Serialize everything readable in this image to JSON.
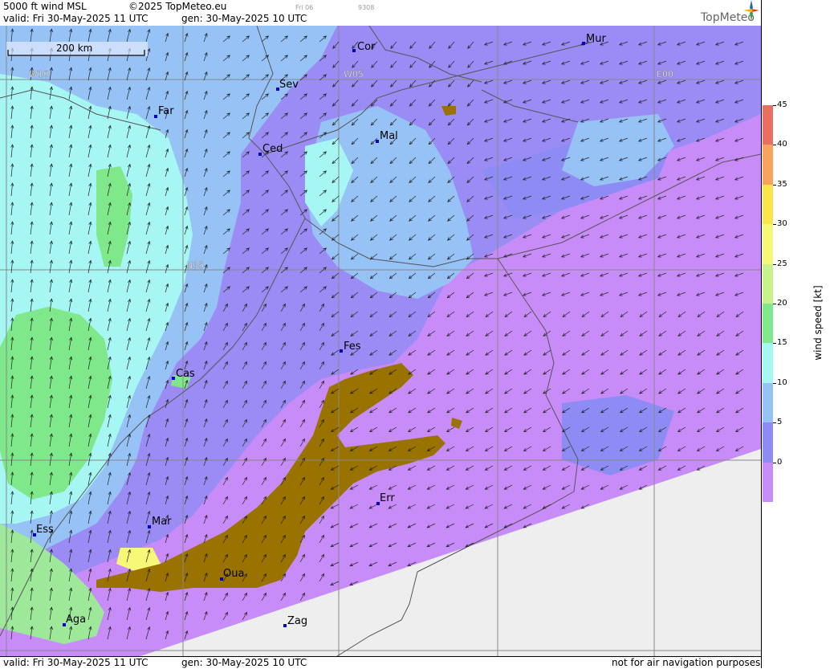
{
  "header": {
    "title": "5000 ft wind MSL",
    "copyright": "©2025 TopMeteo.eu",
    "valid": "valid:  Fri  30-May-2025  11 UTC",
    "gen": "gen: 30-May-2025 10 UTC",
    "small_day": "Fri 06",
    "small_code": "9308",
    "logo": "TopMeteo"
  },
  "footer": {
    "valid": "valid:  Fri  30-May-2025  11 UTC",
    "gen": "gen: 30-May-2025 10 UTC",
    "disclaimer": "not for air navigation purposes"
  },
  "map": {
    "scale_label": "200 km",
    "grid_labels": [
      "W10",
      "W05",
      "E00",
      "N35"
    ],
    "cities": [
      "Cor",
      "Mur",
      "Sev",
      "Far",
      "Ced",
      "Mal",
      "Fes",
      "Cas",
      "Err",
      "Mar",
      "Ess",
      "Oua",
      "Aga",
      "Zag"
    ],
    "colors": {
      "no_data": "#eeeeee",
      "high_terrain": "#9a7200",
      "borders": "#555555",
      "grid": "#888888",
      "city_marker": "#0000cc"
    }
  },
  "legend": {
    "title": "wind speed [kt]",
    "ticks": [
      "45",
      "40",
      "35",
      "30",
      "25",
      "20",
      "15",
      "10",
      "5",
      "0"
    ],
    "colors": [
      "#e87060",
      "#f7a35c",
      "#fce54a",
      "#f8f878",
      "#c8f28a",
      "#7ee88a",
      "#a6f6f4",
      "#96c2f6",
      "#8c8cf4",
      "#c88cf8"
    ]
  }
}
